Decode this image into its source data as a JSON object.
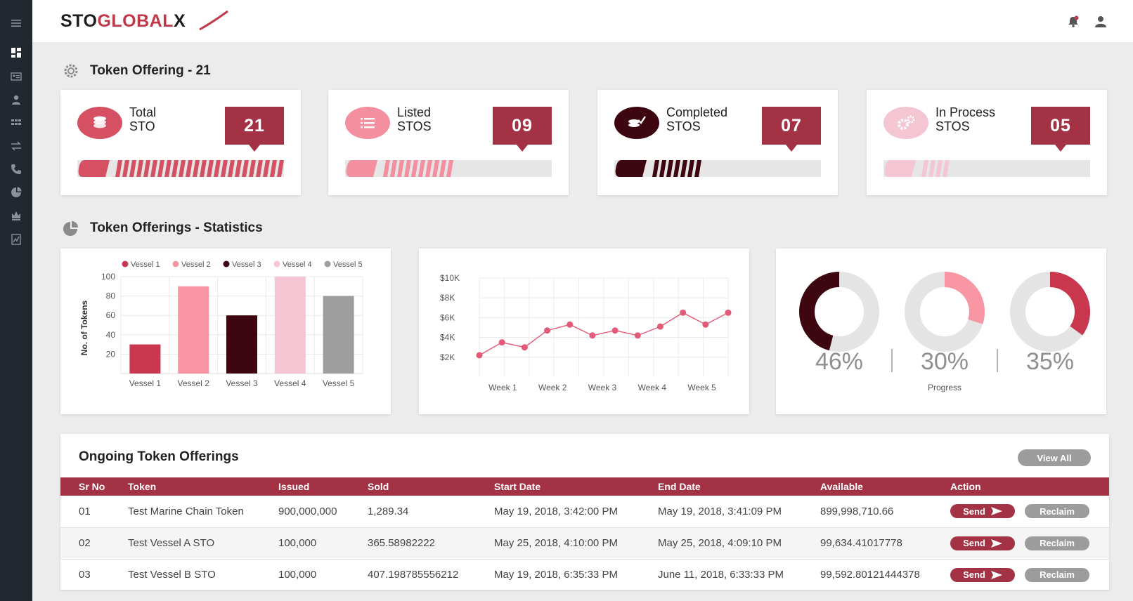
{
  "brand": {
    "part1": "STO",
    "part2": "GLOBAL",
    "part3": "X"
  },
  "sidebar": {
    "items": [
      {
        "icon": "menu-icon"
      },
      {
        "icon": "dashboard-icon"
      },
      {
        "icon": "id-card-icon"
      },
      {
        "icon": "user-icon"
      },
      {
        "icon": "grid-icon"
      },
      {
        "icon": "transfer-icon"
      },
      {
        "icon": "phone-icon"
      },
      {
        "icon": "pie-chart-icon"
      },
      {
        "icon": "crown-icon"
      },
      {
        "icon": "document-icon"
      }
    ]
  },
  "header": {
    "icons": [
      "notification-bell-icon",
      "user-profile-icon"
    ]
  },
  "summary": {
    "title": "Token Offering - 21",
    "cards": [
      {
        "line1": "Total",
        "line2": "STO",
        "value": "21",
        "fill": 1.0,
        "color": "#d45062",
        "icon": "coins-icon"
      },
      {
        "line1": "Listed",
        "line2": "STOS",
        "value": "09",
        "fill": 0.52,
        "color": "#f48fa0",
        "icon": "list-icon"
      },
      {
        "line1": "Completed",
        "line2": "STOS",
        "value": "07",
        "fill": 0.42,
        "color": "#3d0610",
        "icon": "coins-check-icon"
      },
      {
        "line1": "In Process",
        "line2": "STOS",
        "value": "05",
        "fill": 0.34,
        "color": "#f4c5d2",
        "icon": "gears-icon"
      }
    ]
  },
  "statistics": {
    "title": "Token Offerings - Statistics"
  },
  "chart_data": [
    {
      "type": "bar",
      "ylabel": "No. of Tokens",
      "categories": [
        "Vessel 1",
        "Vessel 2",
        "Vessel 3",
        "Vessel 4",
        "Vessel 5"
      ],
      "values": [
        30,
        90,
        60,
        100,
        80
      ],
      "colors": [
        "#c9374e",
        "#f996a4",
        "#3d0610",
        "#f4c5d2",
        "#9e9e9e"
      ],
      "legend": [
        "Vessel 1",
        "Vessel 2",
        "Vessel 3",
        "Vessel 4",
        "Vessel 5"
      ],
      "ylim": [
        0,
        100
      ],
      "yticks": [
        "100",
        "80",
        "60",
        "40",
        "20"
      ],
      "grid": true,
      "legend_position": "top"
    },
    {
      "type": "line",
      "x_categories": [
        "Week 1",
        "Week 2",
        "Week 3",
        "Week 4",
        "Week 5"
      ],
      "yticks": [
        "$10K",
        "$8K",
        "$6K",
        "$4K",
        "$2K"
      ],
      "ylim": [
        0,
        10000
      ],
      "values": [
        2200,
        3500,
        3000,
        4700,
        5300,
        4200,
        4700,
        4200,
        5100,
        6500,
        5300,
        6500
      ],
      "color": "#e35a79",
      "grid": true
    },
    {
      "type": "pie",
      "xlabel": "Progress",
      "values": [
        46,
        30,
        35
      ],
      "labels": [
        "46%",
        "30%",
        "35%"
      ],
      "colors": [
        "#3d0610",
        "#f996a4",
        "#c9374e"
      ],
      "track_color": "#e4e4e4"
    }
  ],
  "table": {
    "title": "Ongoing Token Offerings",
    "view_all": "View All",
    "columns": [
      "Sr No",
      "Token",
      "Issued",
      "Sold",
      "Start Date",
      "End Date",
      "Available",
      "Action"
    ],
    "send_label": "Send",
    "reclaim_label": "Reclaim",
    "rows": [
      [
        "01",
        "Test Marine Chain Token",
        "900,000,000",
        "1,289.34",
        "May 19, 2018, 3:42:00 PM",
        "May 19, 2018, 3:41:09 PM",
        "899,998,710.66"
      ],
      [
        "02",
        "Test Vessel A STO",
        "100,000",
        "365.58982222",
        "May 25, 2018, 4:10:00 PM",
        "May 25, 2018, 4:09:10 PM",
        "99,634.41017778"
      ],
      [
        "03",
        "Test Vessel B STO",
        "100,000",
        "407.198785556212",
        "May 19, 2018, 6:35:33 PM",
        "June 11, 2018, 6:33:33 PM",
        "99,592.80121444378"
      ]
    ]
  }
}
